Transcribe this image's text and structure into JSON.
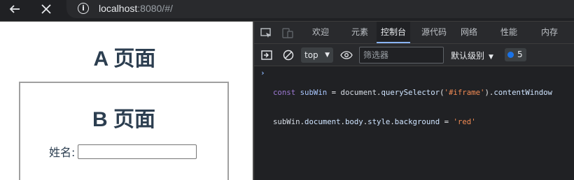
{
  "browser": {
    "url_host": "localhost",
    "url_rest": ":8080/#/",
    "back_icon": "arrow-left-icon",
    "close_icon": "close-icon",
    "info_icon": "info-icon",
    "info_glyph": "i"
  },
  "page": {
    "title": "A 页面",
    "iframe": {
      "title": "B 页面",
      "name_label": "姓名:",
      "name_value": ""
    }
  },
  "devtools": {
    "tabs": [
      {
        "label": "欢迎"
      },
      {
        "label": "元素"
      },
      {
        "label": "控制台"
      },
      {
        "label": "源代码"
      },
      {
        "label": "网络"
      },
      {
        "label": "性能"
      },
      {
        "label": "内存"
      }
    ],
    "active_tab": "控制台",
    "toolbar": {
      "context": "top",
      "filter_placeholder": "筛选器",
      "level": "默认级别",
      "issues_count": "5"
    },
    "console": {
      "prompt": "›",
      "line1": [
        {
          "t": "const ",
          "c": "kw"
        },
        {
          "t": "subWin",
          "c": "var"
        },
        {
          "t": " = ",
          "c": "pun"
        },
        {
          "t": "document",
          "c": "plain"
        },
        {
          "t": ".",
          "c": "pun"
        },
        {
          "t": "querySelector",
          "c": "prop"
        },
        {
          "t": "(",
          "c": "pun"
        },
        {
          "t": "'#iframe'",
          "c": "str"
        },
        {
          "t": ").",
          "c": "pun"
        },
        {
          "t": "contentWindow",
          "c": "prop"
        }
      ],
      "line2": [
        {
          "t": "subWin",
          "c": "plain"
        },
        {
          "t": ".",
          "c": "pun"
        },
        {
          "t": "document",
          "c": "prop"
        },
        {
          "t": ".",
          "c": "pun"
        },
        {
          "t": "body",
          "c": "prop"
        },
        {
          "t": ".",
          "c": "pun"
        },
        {
          "t": "style",
          "c": "prop"
        },
        {
          "t": ".",
          "c": "pun"
        },
        {
          "t": "background",
          "c": "prop"
        },
        {
          "t": " = ",
          "c": "pun"
        },
        {
          "t": "'red'",
          "c": "str"
        }
      ]
    }
  },
  "colors": {
    "accent": "#8ab4f8",
    "heading": "#2c3e50",
    "devtools_bg": "#202124"
  }
}
